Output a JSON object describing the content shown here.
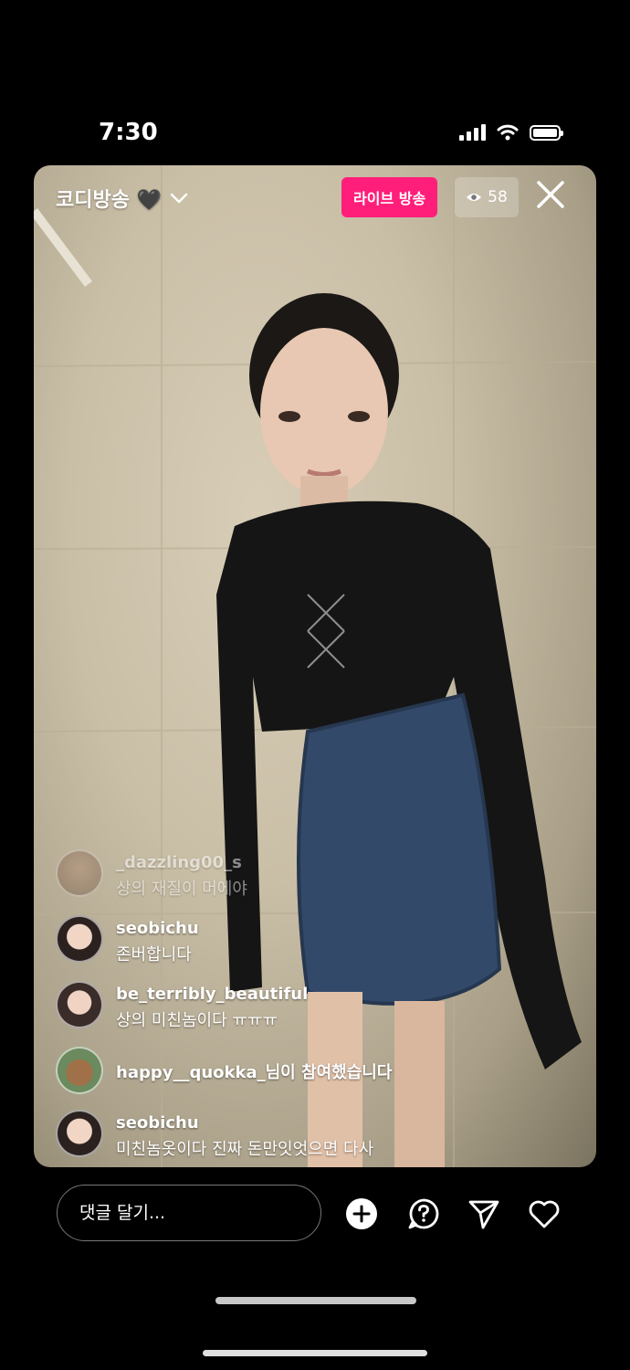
{
  "status_bar": {
    "time": "7:30"
  },
  "live": {
    "room_title": "코디방송 🖤",
    "badge_label": "라이브 방송",
    "viewer_count": "58"
  },
  "comments": [
    {
      "user": "_dazzling00_s",
      "message": "상의 재질이 머에야"
    },
    {
      "user": "seobichu",
      "message": "존버합니다"
    },
    {
      "user": "be_terribly_beautiful",
      "message": "상의 미친놈이다 ㅠㅠㅠ"
    },
    {
      "user": "happy__quokka_",
      "message": "님이 참여했습니다"
    },
    {
      "user": "seobichu",
      "message": "미친놈옷이다 진짜 돈만잇엇으면 다사"
    }
  ],
  "comment_input": {
    "placeholder": "댓글 달기..."
  },
  "icons": [
    "chevron-down-icon",
    "eye-icon",
    "close-icon",
    "add-icon",
    "question-icon",
    "send-icon",
    "heart-icon"
  ],
  "colors": {
    "live_badge": "#ff1f7a",
    "background": "#000000"
  }
}
